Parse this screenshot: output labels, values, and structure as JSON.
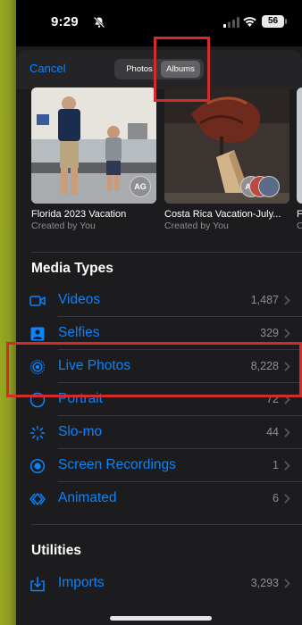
{
  "status": {
    "time": "9:29",
    "battery": "56"
  },
  "header": {
    "cancel_label": "Cancel",
    "tabs": [
      {
        "label": "Photos",
        "selected": false
      },
      {
        "label": "Albums",
        "selected": true
      }
    ]
  },
  "albums": [
    {
      "title": "Florida 2023 Vacation",
      "subtitle": "Created by You",
      "avatar": "AG"
    },
    {
      "title": "Costa Rica Vacation-July...",
      "subtitle": "Created by You",
      "avatar": "AG"
    },
    {
      "title": "F",
      "subtitle": "C"
    }
  ],
  "media_types": {
    "title": "Media Types",
    "items": [
      {
        "label": "Videos",
        "count": "1,487",
        "icon": "video-icon"
      },
      {
        "label": "Selfies",
        "count": "329",
        "icon": "selfie-icon"
      },
      {
        "label": "Live Photos",
        "count": "8,228",
        "icon": "live-photo-icon"
      },
      {
        "label": "Portrait",
        "count": "72",
        "icon": "portrait-icon"
      },
      {
        "label": "Slo-mo",
        "count": "44",
        "icon": "slomo-icon"
      },
      {
        "label": "Screen Recordings",
        "count": "1",
        "icon": "screen-recording-icon"
      },
      {
        "label": "Animated",
        "count": "6",
        "icon": "animated-icon"
      }
    ]
  },
  "utilities": {
    "title": "Utilities",
    "items": [
      {
        "label": "Imports",
        "count": "3,293",
        "icon": "import-icon"
      }
    ]
  },
  "colors": {
    "accent": "#0a84ff",
    "annotation": "#d32b2b",
    "background": "#1c1c1e"
  }
}
